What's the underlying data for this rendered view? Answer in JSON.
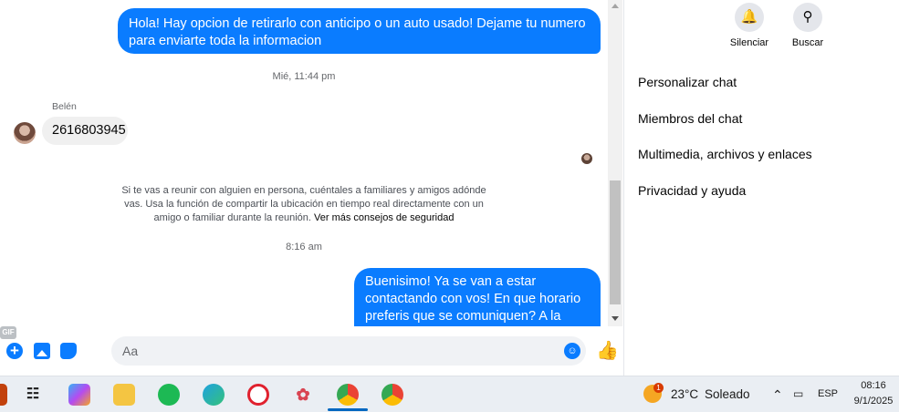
{
  "chat": {
    "messages_out": [
      "Hola! Hay opcion de retirarlo con anticipo o un auto usado! Dejame tu numero para enviarte toda la informacion",
      "Buenisimo! Ya se van a estar contactando con vos! En que horario preferis que se comuniquen? A la mañana o a la tarde?"
    ],
    "timestamp_1": "Mié, 11:44 pm",
    "sender_name": "Belén",
    "message_in": "2616803945",
    "safety_text": "Si te vas a reunir con alguien en persona, cuéntales a familiares y amigos adónde vas. Usa la función de compartir la ubicación en tiempo real directamente con un amigo o familiar durante la reunión. ",
    "safety_link": "Ver más consejos de seguridad",
    "timestamp_2": "8:16 am"
  },
  "composer": {
    "placeholder": "Aa",
    "gif_label": "GIF"
  },
  "panel": {
    "mute_label": "Silenciar",
    "search_label": "Buscar",
    "items": [
      "Personalizar chat",
      "Miembros del chat",
      "Multimedia, archivos y enlaces",
      "Privacidad y ayuda"
    ]
  },
  "taskbar": {
    "weather_temp": "23°C",
    "weather_desc": "Soleado",
    "weather_badge": "1",
    "language": "ESP",
    "time": "08:16",
    "date": "9/1/2025"
  },
  "colors": {
    "accent": "#0a7cff",
    "bubble_in": "#f0f0f0"
  }
}
